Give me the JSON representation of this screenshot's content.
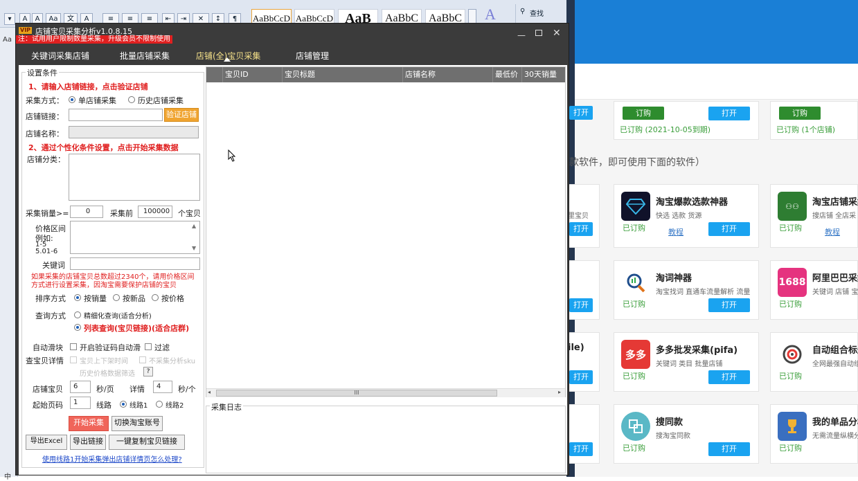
{
  "word": {
    "styles": [
      "AaBbCcD",
      "AaBbCcD",
      "AaB",
      "AaBbC",
      "AaBbC"
    ],
    "find_label": "查找",
    "left_text": "Aa",
    "bottom_left": "中"
  },
  "store": {
    "note": "款软件，即可使用下面的软件）",
    "order_label": "订购",
    "open_label": "打开",
    "owned_label": "已订购",
    "tutorial_label": "教程",
    "owned_date": "已订购 (2021-10-05到期)",
    "owned_one": "已订购 (1个店铺)",
    "partial_sub": "里宝贝",
    "partial_ile": "ile)",
    "cards": [
      {
        "title": "淘宝爆款选款神器",
        "sub": "快选 选款 货源",
        "icon": "diamond-icon",
        "color": "#1a1a2e"
      },
      {
        "title": "淘宝店铺采集",
        "sub": "搜店铺 全店采",
        "icon": "people-icon",
        "color": "#2e7d32"
      },
      {
        "title": "淘词神器",
        "sub": "淘宝找词 直通车流量解析 流量",
        "icon": "magnifier-icon",
        "color": "#ffffff"
      },
      {
        "title": "阿里巴巴采集",
        "sub": "关键词 店铺 宝",
        "icon": "1688-icon",
        "color": "#e5337f",
        "icon_text": "1688"
      },
      {
        "title": "多多批发采集(pifa)",
        "sub": "关键词 类目 批量店铺",
        "icon": "duoduo-icon",
        "color": "#e53935",
        "icon_text": "多多"
      },
      {
        "title": "自动组合标题",
        "sub": "全网最强自动组",
        "icon": "target-icon",
        "color": "#ffffff"
      },
      {
        "title": "搜同款",
        "sub": "搜淘宝同款",
        "icon": "same-icon",
        "color": "#5ab8c6"
      },
      {
        "title": "我的单品分析",
        "sub": "无需流量纵横分",
        "icon": "trophy-icon",
        "color": "#3a6fc0"
      }
    ]
  },
  "app": {
    "badge": "VIP",
    "title": "店铺宝贝采集分析v1.0.8.15",
    "notice": "注：试用用户限制数量采集，升级会员不限制使用",
    "tabs": [
      "关键词采集店铺",
      "批量店铺采集",
      "店铺(全)宝贝采集",
      "店铺管理"
    ],
    "active_tab": 2,
    "form": {
      "group_title": "设置条件",
      "step1": "1、请输入店铺链接，点击验证店铺",
      "mode_label": "采集方式：",
      "mode_single": "单店铺采集",
      "mode_history": "历史店铺采集",
      "link_label": "店铺链接：",
      "verify_btn": "验证店铺",
      "name_label": "店铺名称：",
      "step2": "2、通过个性化条件设置，点击开始采集数据",
      "category_label": "店铺分类：",
      "sales_label": "采集销量>=",
      "sales_value": "0",
      "top_label": "采集前",
      "top_value": "100000",
      "top_unit": "个宝贝",
      "price_label": "价格区间",
      "price_example": "例如:",
      "price_ex1": "1-5",
      "price_ex2": "5.01-6",
      "keyword_label": "关键词",
      "warning1": "如果采集的店铺宝贝总数超过2340个，请用价格区间",
      "warning2": "方式进行设置采集，因淘宝需要保护店铺的宝贝",
      "sort_label": "排序方式",
      "sort_options": [
        "按销量",
        "按新品",
        "按价格"
      ],
      "query_label": "查询方式",
      "query_detail": "精细化查询(适合分析)",
      "query_list": "列表查询(宝贝链接)(适合店群)",
      "auto_label": "自动滑块",
      "auto_captcha": "开启验证码自动滑",
      "auto_filter": "过滤",
      "detail_label": "查宝贝详情",
      "detail_opt1": "宝贝上下架时间",
      "detail_opt2": "不采集分析sku",
      "history_label": "历史价格数据筛选",
      "history_q": "?",
      "shop_label": "店铺宝贝",
      "shop_value": "6",
      "shop_unit": "秒/页",
      "detail_rate_label": "详情",
      "detail_rate_value": "4",
      "detail_rate_unit": "秒/个",
      "start_label": "起始页码",
      "start_value": "1",
      "line_label": "线路",
      "line1": "线路1",
      "line2": "线路2",
      "start_btn": "开始采集",
      "switch_btn": "切换淘宝账号",
      "export_excel": "导出Excel",
      "export_link": "导出链接",
      "copy_btn": "一键复制宝贝链接",
      "help_link": "使用线路1开始采集弹出店铺详情页怎么处理?"
    },
    "table": {
      "columns": [
        "宝贝ID",
        "宝贝标题",
        "店铺名称",
        "最低价",
        "30天销量"
      ],
      "scroll_label": "III"
    },
    "log_title": "采集日志"
  }
}
